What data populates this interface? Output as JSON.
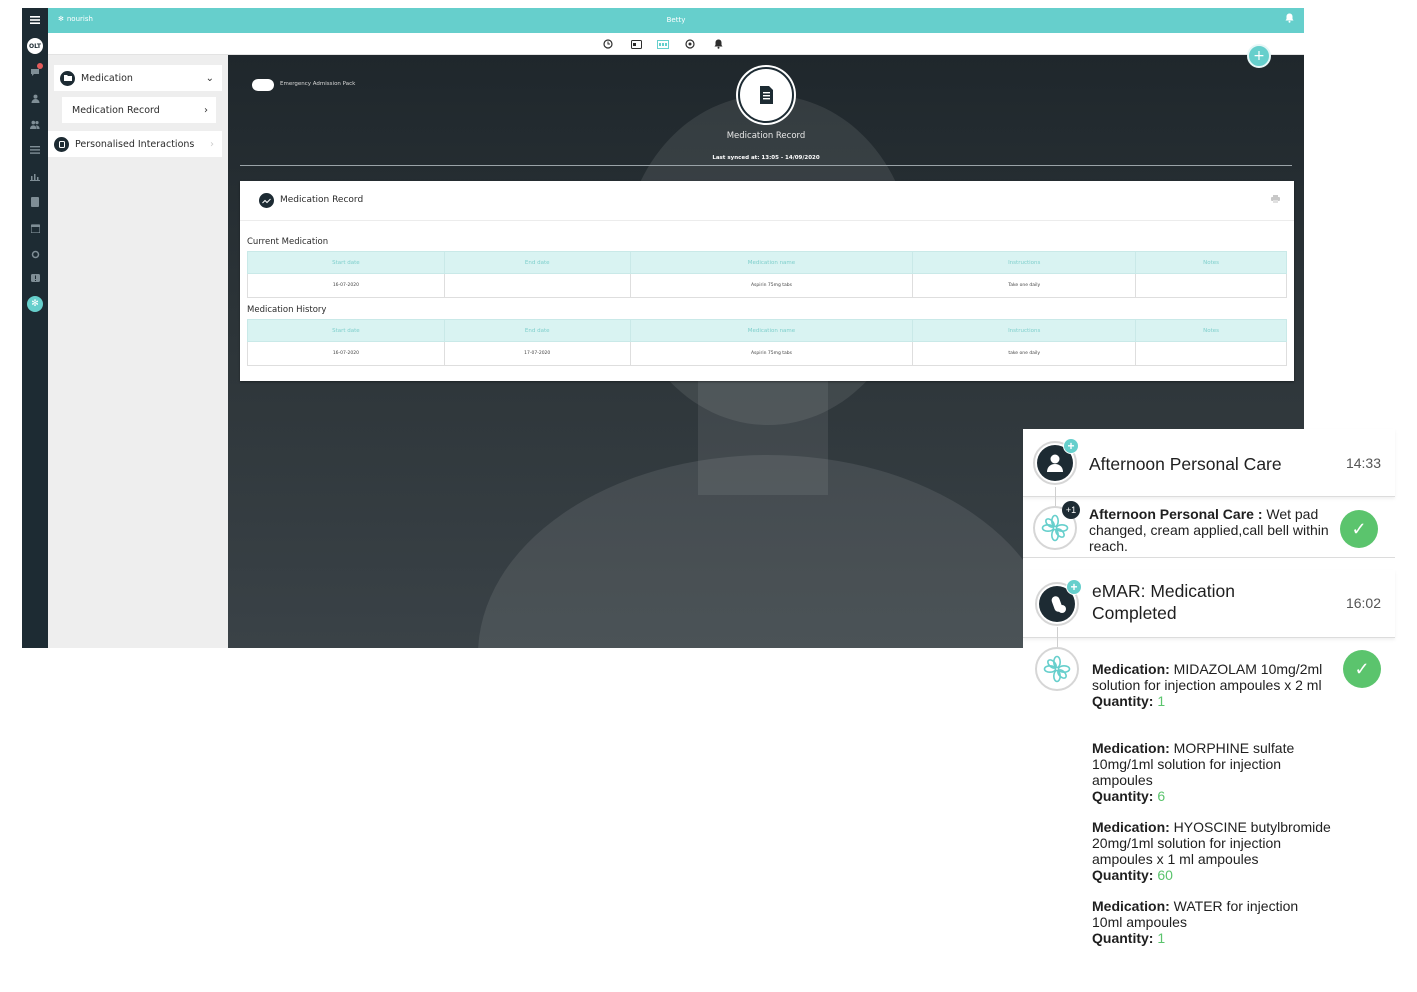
{
  "app": {
    "brand": "nourish",
    "user_name": "Betty",
    "rail": {
      "avatar_initials": "OLT"
    },
    "side_menu": {
      "items": [
        {
          "label": "Medication"
        },
        {
          "label": "Medication Record"
        },
        {
          "label": "Personalised Interactions"
        }
      ]
    },
    "content": {
      "toggle_label": "Emergency Admission Pack",
      "record_title": "Medication Record",
      "last_synced": "Last synced at: 13:05 - 14/09/2020",
      "card": {
        "title": "Medication Record",
        "current_section": "Current Medication",
        "history_section": "Medication History",
        "columns": [
          "Start date",
          "End date",
          "Medication name",
          "Instructions",
          "Notes"
        ],
        "current_rows": [
          {
            "start": "16-07-2020",
            "end": "",
            "name": "Aspirin 75mg tabs",
            "instructions": "Take one daily",
            "notes": ""
          }
        ],
        "history_rows": [
          {
            "start": "16-07-2020",
            "end": "17-07-2020",
            "name": "Aspirin 75mg tabs",
            "instructions": "take one daily",
            "notes": ""
          }
        ]
      }
    }
  },
  "timeline": {
    "event1": {
      "title": "Afternoon Personal Care",
      "time": "14:33",
      "badge": "+1",
      "note_bold": "Afternoon Personal Care :",
      "note_text": " Wet pad changed, cream applied,call bell within reach."
    },
    "event2": {
      "title": "eMAR: Medication Completed",
      "time": "16:02",
      "med_label": "Medication:",
      "qty_label": "Quantity:",
      "medications": [
        {
          "name": " MIDAZOLAM 10mg/2ml solution for injection ampoules x 2 ml",
          "quantity": "1"
        },
        {
          "name": " MORPHINE sulfate 10mg/1ml solution for injection ampoules",
          "quantity": "6"
        },
        {
          "name": " HYOSCINE butylbromide 20mg/1ml solution for injection ampoules x 1 ml ampoules",
          "quantity": "60"
        },
        {
          "name": " WATER for injection 10ml ampoules",
          "quantity": "1"
        }
      ]
    }
  },
  "colors": {
    "accent": "#66cfcc",
    "dark": "#1d2b33",
    "success": "#5bc46d"
  }
}
